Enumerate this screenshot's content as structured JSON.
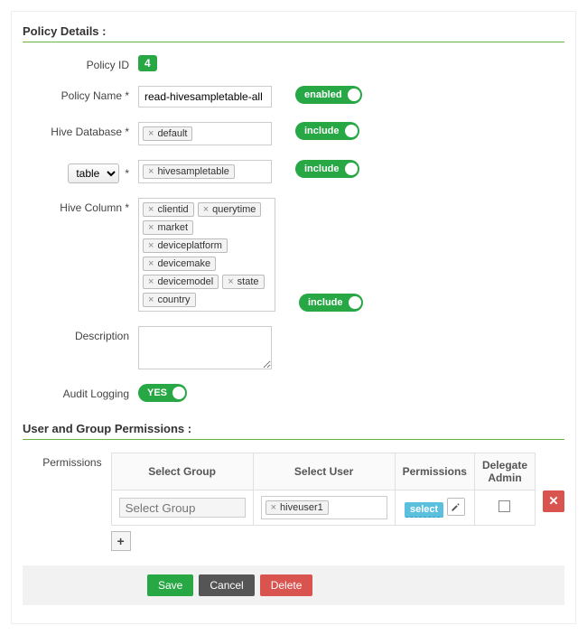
{
  "section1_title": "Policy Details :",
  "section2_title": "User and Group Permissions :",
  "labels": {
    "policy_id": "Policy ID",
    "policy_name": "Policy Name *",
    "hive_db": "Hive Database *",
    "table_asterisk": "*",
    "table_option": "table",
    "hive_column": "Hive Column *",
    "description": "Description",
    "audit_logging": "Audit Logging",
    "permissions": "Permissions"
  },
  "values": {
    "policy_id": "4",
    "policy_name": "read-hivesampletable-all",
    "hive_db_tags": [
      "default"
    ],
    "table_tags": [
      "hivesampletable"
    ],
    "column_tags": [
      "clientid",
      "querytime",
      "market",
      "deviceplatform",
      "devicemake",
      "devicemodel",
      "state",
      "country"
    ],
    "description": "",
    "select_user_tags": [
      "hiveuser1"
    ]
  },
  "toggles": {
    "enabled": "enabled",
    "include": "include",
    "yes": "YES"
  },
  "perm_headers": {
    "group": "Select Group",
    "user": "Select User",
    "perms": "Permissions",
    "admin": "Delegate Admin"
  },
  "perm_row": {
    "group_placeholder": "Select Group",
    "perm_badge": "select"
  },
  "buttons": {
    "save": "Save",
    "cancel": "Cancel",
    "delete": "Delete"
  }
}
